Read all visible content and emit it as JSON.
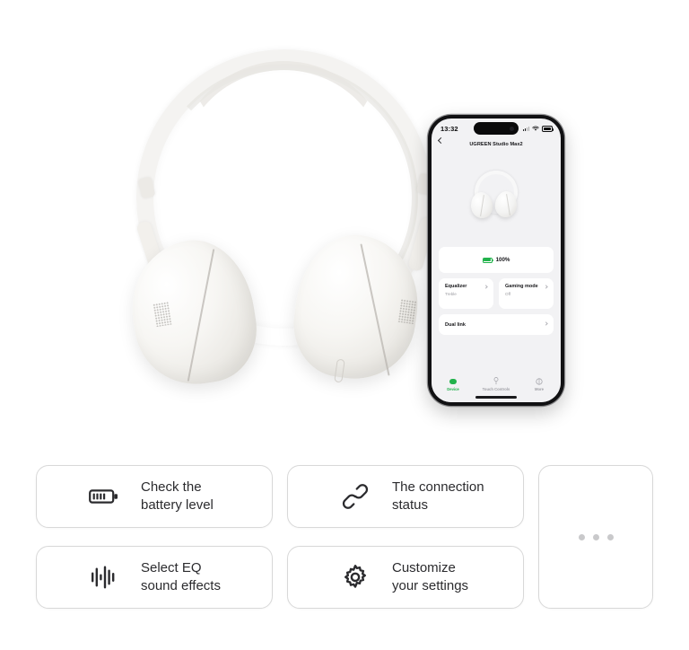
{
  "product": {
    "name": "UGREEN Studio Max2",
    "type": "over-ear-headphones",
    "color": "#f4f3f1"
  },
  "phone": {
    "status_bar": {
      "time": "13:32",
      "cellular_icon": "cellular-signal-icon",
      "wifi_icon": "wifi-icon",
      "battery_icon": "battery-icon"
    },
    "nav": {
      "back_icon": "back-chevron-icon",
      "title": "UGREEN Studio Max2"
    },
    "battery_card": {
      "icon": "battery-icon",
      "percent": "100%",
      "accent": "#21b24b"
    },
    "settings": [
      {
        "title": "Equalizer",
        "value": "Treble",
        "chevron": "chevron-right-icon"
      },
      {
        "title": "Gaming mode",
        "value": "Off",
        "chevron": "chevron-right-icon"
      }
    ],
    "dual_link": {
      "title": "Dual link",
      "chevron": "chevron-right-icon"
    },
    "tabs": [
      {
        "label": "Device",
        "icon": "device-icon",
        "active": true
      },
      {
        "label": "Touch Controls",
        "icon": "touch-controls-icon",
        "active": false
      },
      {
        "label": "More",
        "icon": "more-circle-icon",
        "active": false
      }
    ]
  },
  "features": [
    {
      "icon": "battery-icon",
      "label": "Check the\nbattery level"
    },
    {
      "icon": "link-icon",
      "label": "The connection\nstatus"
    },
    {
      "icon": "equalizer-icon",
      "label": "Select EQ\nsound effects"
    },
    {
      "icon": "gear-icon",
      "label": "Customize\nyour settings"
    }
  ],
  "more_card": {
    "icon": "ellipsis-icon",
    "dot_color": "#c9c9cb"
  }
}
